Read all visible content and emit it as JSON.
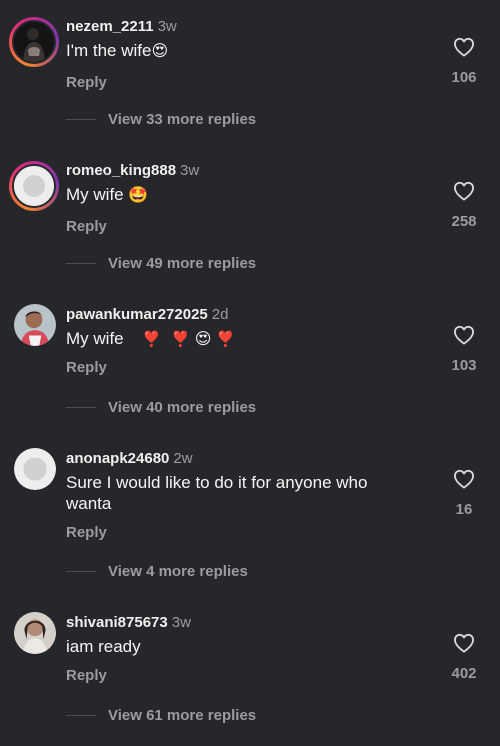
{
  "comments": [
    {
      "username": "nezem_2211",
      "time": "3w",
      "text": "I'm the wife",
      "emojis": [
        "😍"
      ],
      "reply_label": "Reply",
      "likes": "106",
      "view_replies": "View 33 more replies",
      "avatar": "photo-person-dark"
    },
    {
      "username": "romeo_king888",
      "time": "3w",
      "text": "My wife",
      "emojis": [
        "🤩"
      ],
      "reply_label": "Reply",
      "likes": "258",
      "view_replies": "View 49 more replies",
      "avatar": "default-avatar-with-story-ring"
    },
    {
      "username": "pawankumar272025",
      "time": "2d",
      "text": "My wife",
      "emojis": [
        "❣️",
        "❣️",
        "😍",
        "❣️"
      ],
      "reply_label": "Reply",
      "likes": "103",
      "view_replies": "View 40 more replies",
      "avatar": "photo-person"
    },
    {
      "username": "anonapk24680",
      "time": "2w",
      "text": "Sure I would like to do it for anyone who wanta",
      "emojis": [],
      "reply_label": "Reply",
      "likes": "16",
      "view_replies": "View 4 more replies",
      "avatar": "default-avatar"
    },
    {
      "username": "shivani875673",
      "time": "3w",
      "text": "iam ready",
      "emojis": [],
      "reply_label": "Reply",
      "likes": "402",
      "view_replies": "View 61 more replies",
      "avatar": "photo-person-light"
    }
  ],
  "icons": {
    "like": "heart-outline-icon"
  },
  "colors": {
    "background": "#25272b",
    "muted": "#9a9ca1",
    "text": "#f5f5f5",
    "story_ring": "#dd2a7b"
  }
}
